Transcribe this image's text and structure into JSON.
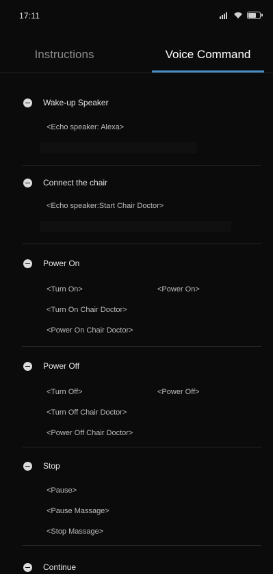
{
  "status_bar": {
    "time": "17:11",
    "icons": [
      "signal-icon",
      "wifi-icon",
      "battery-icon"
    ],
    "battery_level_fraction": 0.8
  },
  "tabs": [
    {
      "label": "Instructions",
      "selected": false
    },
    {
      "label": "Voice Command",
      "selected": true
    }
  ],
  "colors": {
    "background": "#0b0b0b",
    "accent": "#4a90c8",
    "text_primary": "#e6e6e6",
    "text_secondary": "#bdbdbd",
    "text_inactive": "#8a8a8a"
  },
  "sections": [
    {
      "title": "Wake-up Speaker",
      "commands": [
        "<Echo speaker: Alexa>"
      ]
    },
    {
      "title": "Connect the chair",
      "commands": [
        "<Echo speaker:Start Chair Doctor>"
      ]
    },
    {
      "title": "Power On",
      "commands": [
        "<Turn On>",
        "<Power On>",
        "<Turn On Chair Doctor>",
        "<Power On Chair Doctor>"
      ]
    },
    {
      "title": "Power Off",
      "commands": [
        "<Turn Off>",
        "<Power Off>",
        "<Turn Off Chair Doctor>",
        "<Power Off Chair Doctor>"
      ]
    },
    {
      "title": "Stop",
      "commands": [
        "<Pause>",
        "<Pause Massage>",
        "<Stop Massage>"
      ]
    },
    {
      "title": "Continue",
      "commands": []
    }
  ]
}
